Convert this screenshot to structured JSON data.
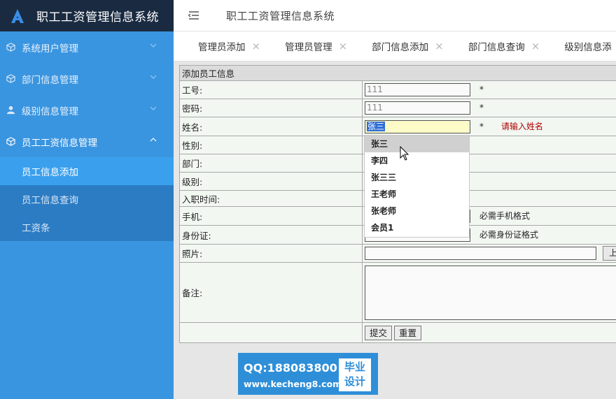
{
  "app": {
    "brand_title": "职工工资管理信息系统"
  },
  "header": {
    "title": "职工工资管理信息系统"
  },
  "sidebar": {
    "items": [
      {
        "label": "系统用户管理",
        "icon": "cube-icon"
      },
      {
        "label": "部门信息管理",
        "icon": "cube-icon"
      },
      {
        "label": "级别信息管理",
        "icon": "user-icon"
      },
      {
        "label": "员工工资信息管理",
        "icon": "cube-icon"
      }
    ],
    "subitems": [
      {
        "label": "员工信息添加",
        "active": true
      },
      {
        "label": "员工信息查询"
      },
      {
        "label": "工资条"
      }
    ]
  },
  "tabs": [
    {
      "label": "管理员添加"
    },
    {
      "label": "管理员管理"
    },
    {
      "label": "部门信息添加"
    },
    {
      "label": "部门信息查询"
    },
    {
      "label": "级别信息添"
    }
  ],
  "form": {
    "caption": "添加员工信息",
    "fields": {
      "job_no": {
        "label": "工号:",
        "value": "111",
        "required": "*"
      },
      "password": {
        "label": "密码:",
        "value": "111",
        "required": "*"
      },
      "name": {
        "label": "姓名:",
        "value": "张三",
        "required": "*",
        "error": "请输入姓名"
      },
      "gender": {
        "label": "性别:"
      },
      "department": {
        "label": "部门:"
      },
      "level": {
        "label": "级别:"
      },
      "hire_date": {
        "label": "入职时间:"
      },
      "phone": {
        "label": "手机:",
        "hint": "必需手机格式"
      },
      "id_card": {
        "label": "身份证:",
        "hint": "必需身份证格式"
      },
      "photo": {
        "label": "照片:",
        "upload_label": "上"
      },
      "remark": {
        "label": "备注:"
      }
    },
    "submit_label": "提交",
    "reset_label": "重置"
  },
  "autocomplete": {
    "options": [
      "张三",
      "李四",
      "张三三",
      "王老师",
      "张老师",
      "会员1"
    ],
    "highlighted_index": 0
  },
  "watermark": {
    "qq": "QQ:188083800",
    "url": "www.kecheng8.com",
    "box_line1": "毕业",
    "box_line2": "设计"
  },
  "colors": {
    "sidebar_bg": "#3a95e0",
    "brand_bg": "#1a2b41",
    "submenu_bg": "#2c7cc4",
    "active_sub": "#3aa0ee",
    "error_red": "#b00000"
  }
}
